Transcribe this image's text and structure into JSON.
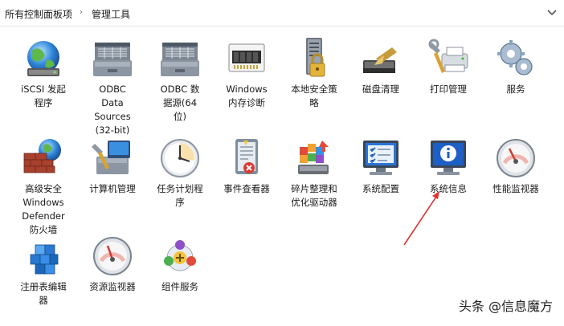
{
  "breadcrumb": {
    "items": [
      {
        "label": "所有控制面板项"
      },
      {
        "label": "管理工具"
      }
    ],
    "separator": "›"
  },
  "items": [
    {
      "label": "iSCSI 发起\n程序",
      "icon": "iscsi-globe-icon"
    },
    {
      "label": "ODBC\nData\nSources\n(32-bit)",
      "icon": "odbc-32-icon"
    },
    {
      "label": "ODBC 数\n据源(64\n位)",
      "icon": "odbc-64-icon"
    },
    {
      "label": "Windows\n内存诊断",
      "icon": "memory-chip-icon"
    },
    {
      "label": "本地安全策\n略",
      "icon": "server-lock-icon"
    },
    {
      "label": "磁盘清理",
      "icon": "disk-cleanup-icon"
    },
    {
      "label": "打印管理",
      "icon": "printer-icon"
    },
    {
      "label": "服务",
      "icon": "gears-icon"
    },
    {
      "label": "高级安全\nWindows\nDefender\n防火墙",
      "icon": "firewall-globe-icon"
    },
    {
      "label": "计算机管理",
      "icon": "computer-management-icon"
    },
    {
      "label": "任务计划程\n序",
      "icon": "clock-icon"
    },
    {
      "label": "事件查看器",
      "icon": "event-log-icon"
    },
    {
      "label": "碎片整理和\n优化驱动器",
      "icon": "defrag-icon"
    },
    {
      "label": "系统配置",
      "icon": "system-config-icon"
    },
    {
      "label": "系统信息",
      "icon": "system-info-icon"
    },
    {
      "label": "性能监视器",
      "icon": "performance-gauge-icon"
    },
    {
      "label": "注册表编辑\n器",
      "icon": "registry-cubes-icon"
    },
    {
      "label": "资源监视器",
      "icon": "resource-gauge-icon"
    },
    {
      "label": "组件服务",
      "icon": "component-services-icon"
    }
  ],
  "colors": {
    "accent_blue": "#2b6fd6",
    "arrow_red": "#e0322f",
    "background": "#ffffff"
  },
  "watermark": "头条 @信息魔方"
}
